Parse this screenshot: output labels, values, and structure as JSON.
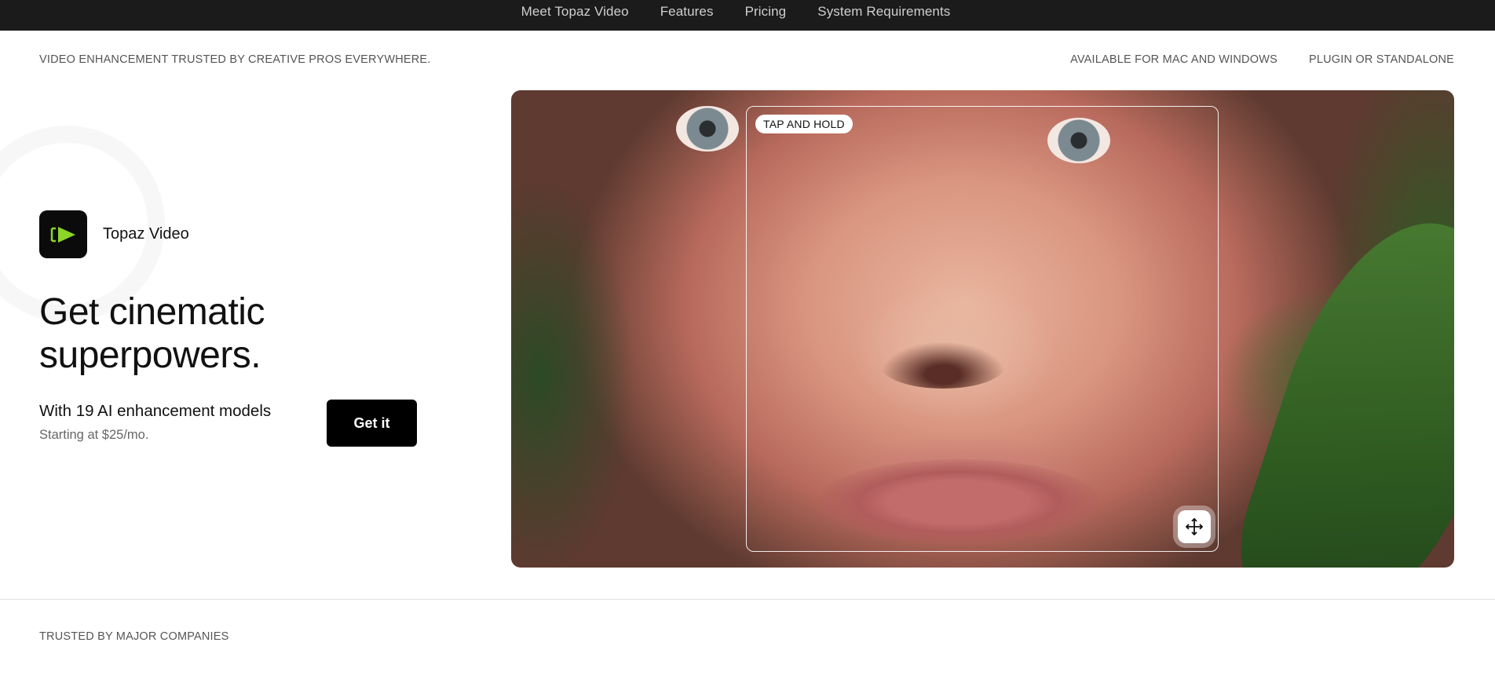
{
  "nav": {
    "items": [
      {
        "label": "Meet Topaz Video"
      },
      {
        "label": "Features"
      },
      {
        "label": "Pricing"
      },
      {
        "label": "System Requirements"
      }
    ]
  },
  "tagline": "VIDEO ENHANCEMENT TRUSTED BY CREATIVE PROS EVERYWHERE.",
  "availability": {
    "platforms": "AVAILABLE FOR MAC AND WINDOWS",
    "mode": "PLUGIN OR STANDALONE"
  },
  "product": {
    "name": "Topaz Video",
    "icon": "play-icon",
    "icon_color": "#8bd627"
  },
  "hero": {
    "headline": "Get cinematic superpowers.",
    "models_text": "With 19 AI enhancement models",
    "price_text": "Starting at $25/mo.",
    "cta_label": "Get it"
  },
  "comparison": {
    "hint_label": "TAP AND HOLD",
    "move_icon": "move-arrows-icon"
  },
  "trusted": {
    "label": "TRUSTED BY MAJOR COMPANIES"
  },
  "colors": {
    "nav_bg": "#1b1b1b",
    "button_bg": "#000000",
    "accent": "#8bd627"
  }
}
